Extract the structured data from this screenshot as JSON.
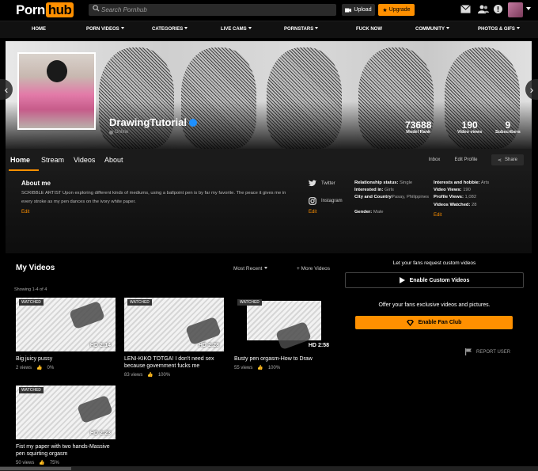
{
  "header": {
    "logo_part1": "Porn",
    "logo_part2": "hub",
    "search_placeholder": "Search Pornhub",
    "upload_label": "Upload",
    "upgrade_label": "Upgrade",
    "icons": [
      "search-icon",
      "camera-icon",
      "star-icon",
      "mail-icon",
      "users-icon",
      "alert-icon"
    ]
  },
  "nav": {
    "items": [
      "HOME",
      "PORN VIDEOS",
      "CATEGORIES",
      "LIVE CAMS",
      "PORNSTARS",
      "FUCK NOW",
      "COMMUNITY",
      "PHOTOS & GIFS"
    ]
  },
  "profile": {
    "name": "DrawingTutorial",
    "status": "Online",
    "stats": [
      {
        "value": "73688",
        "label": "Model Rank"
      },
      {
        "value": "190",
        "label": "Video views"
      },
      {
        "value": "9",
        "label": "Subscribers"
      }
    ]
  },
  "tabs": {
    "items": [
      "Home",
      "Stream",
      "Videos",
      "About"
    ],
    "active": "Home",
    "inbox_label": "Inbox",
    "edit_profile_label": "Edit Profile",
    "share_label": "Share"
  },
  "about": {
    "title": "About me",
    "text": "SCRIBBLE ARTIST Upon exploring different kinds of mediums, using a ballpoint pen is by far my favorite. The peace it gives me in every stroke as my pen dances on the ivory white paper.",
    "edit_label": "Edit",
    "social": [
      {
        "icon": "twitter-icon",
        "label": "Twitter"
      },
      {
        "icon": "instagram-icon",
        "label": "Instagram"
      }
    ],
    "social_edit_label": "Edit",
    "personal": [
      {
        "k": "Relationship status:",
        "v": "Single"
      },
      {
        "k": "Interested in:",
        "v": "Girls"
      },
      {
        "k": "City and Country:",
        "v": "Pasay, Philippines"
      },
      {
        "k": "Gender:",
        "v": "Male"
      }
    ],
    "activity": [
      {
        "k": "Interests and hobbie:",
        "v": "Arts"
      },
      {
        "k": "Video Views:",
        "v": "190"
      },
      {
        "k": "Profile Views:",
        "v": "1,082"
      },
      {
        "k": "Videos Watched:",
        "v": "28"
      }
    ],
    "info_edit_label": "Edit"
  },
  "videos": {
    "title": "My Videos",
    "sort_label": "Most Recent",
    "more_label": "+ More Videos",
    "showing": "Showing 1-4 of 4",
    "watched_label": "WATCHED",
    "hd_label": "HD",
    "items": [
      {
        "title": "Big juicy pussy",
        "duration": "2:14",
        "views": "2 views",
        "rating": "0%"
      },
      {
        "title": "LENI-KIKO TOTGA! I don't need sex because government fucks me",
        "duration": "2:28",
        "views": "83 views",
        "rating": "100%"
      },
      {
        "title": "Busty pen orgasm-How to Draw",
        "duration": "2:58",
        "views": "55 views",
        "rating": "100%"
      },
      {
        "title": "Fist my paper with two hands-Massive pen squirting orgasm",
        "duration": "2:23",
        "views": "50 views",
        "rating": "75%"
      }
    ]
  },
  "sidebar": {
    "custom_prompt": "Let your fans request custom videos",
    "custom_button": "Enable Custom Videos",
    "fan_prompt": "Offer your fans exclusive videos and pictures.",
    "fan_button": "Enable Fan Club",
    "report_label": "REPORT USER"
  },
  "colors": {
    "accent": "#ff9000",
    "background": "#000000",
    "panel": "#1b1b1b",
    "verified": "#1e90ff"
  }
}
